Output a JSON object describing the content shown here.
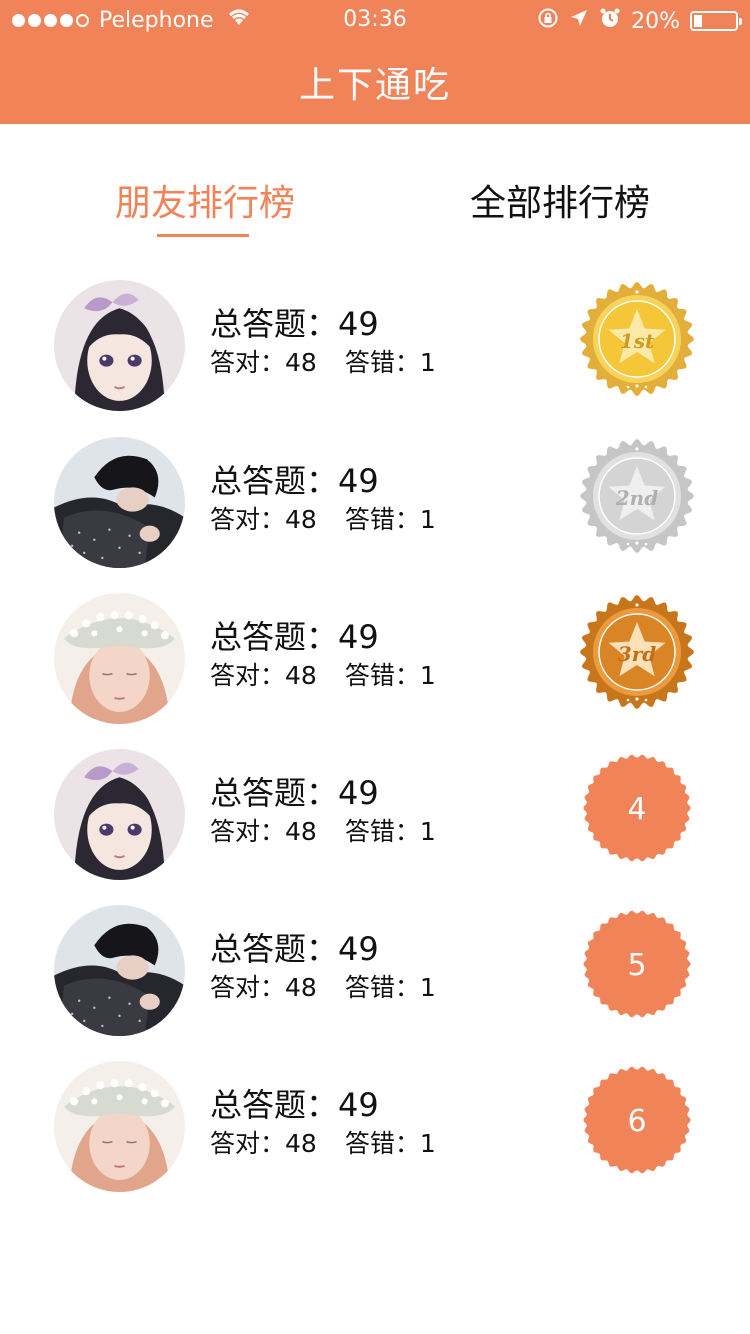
{
  "status_bar": {
    "carrier": "Pelephone",
    "time": "03:36",
    "battery_text": "20%",
    "battery_level": 0.2,
    "icons": [
      "signal-dots-icon",
      "wifi-icon",
      "rotation-lock-icon",
      "location-arrow-icon",
      "alarm-icon",
      "battery-icon"
    ]
  },
  "header": {
    "title": "上下通吃"
  },
  "tabs": [
    {
      "label": "朋友排行榜",
      "active": true
    },
    {
      "label": "全部排行榜",
      "active": false
    }
  ],
  "ranking": {
    "total_label": "总答题：",
    "correct_label": "答对：",
    "wrong_label": "答错：",
    "rows": [
      {
        "rank": "1st",
        "total": "49",
        "correct": "48",
        "wrong": "1",
        "badge": "gold-medal",
        "avatar": "girl-bow-avatar"
      },
      {
        "rank": "2nd",
        "total": "49",
        "correct": "48",
        "wrong": "1",
        "badge": "silver-medal",
        "avatar": "boy-scarf-avatar"
      },
      {
        "rank": "3rd",
        "total": "49",
        "correct": "48",
        "wrong": "1",
        "badge": "bronze-medal",
        "avatar": "girl-flower-crown-avatar"
      },
      {
        "rank": "4",
        "total": "49",
        "correct": "48",
        "wrong": "1",
        "badge": "number",
        "avatar": "girl-bow-avatar"
      },
      {
        "rank": "5",
        "total": "49",
        "correct": "48",
        "wrong": "1",
        "badge": "number",
        "avatar": "boy-scarf-avatar"
      },
      {
        "rank": "6",
        "total": "49",
        "correct": "48",
        "wrong": "1",
        "badge": "number",
        "avatar": "girl-flower-crown-avatar"
      }
    ]
  },
  "colors": {
    "accent": "#f18359",
    "gold": "#e8b33a",
    "silver": "#c4c4c4",
    "bronze": "#cf7d1d"
  }
}
